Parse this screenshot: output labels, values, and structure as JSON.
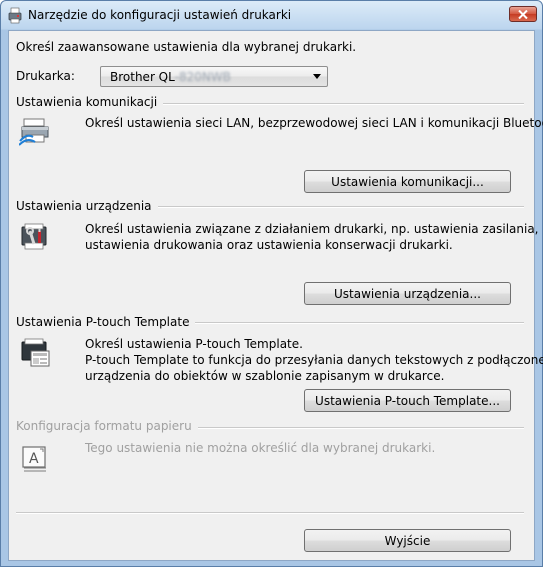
{
  "window": {
    "title": "Narzędzie do konfiguracji ustawień drukarki"
  },
  "intro": "Określ zaawansowane ustawienia dla wybranej drukarki.",
  "printer": {
    "label": "Drukarka:",
    "value_prefix": "Brother QL",
    "value_masked": "-820NWB"
  },
  "sections": {
    "communication": {
      "title": "Ustawienia komunikacji",
      "desc_lines": [
        "Określ ustawienia sieci LAN, bezprzewodowej sieci LAN i komunikacji Bluetooth."
      ],
      "button": "Ustawienia komunikacji..."
    },
    "device": {
      "title": "Ustawienia urządzenia",
      "desc_lines": [
        "Określ ustawienia związane z działaniem drukarki, np. ustawienia zasilania,",
        "ustawienia drukowania oraz ustawienia konserwacji drukarki."
      ],
      "button": "Ustawienia urządzenia..."
    },
    "ptouch": {
      "title": "Ustawienia P-touch Template",
      "desc_lines": [
        "Określ ustawienia P-touch Template.",
        "P-touch Template to funkcja do przesyłania danych tekstowych z podłączonego",
        "urządzenia do obiektów w szablonie zapisanym w drukarce."
      ],
      "button": "Ustawienia P-touch Template..."
    },
    "paper": {
      "title": "Konfiguracja formatu papieru",
      "desc_lines": [
        "Tego ustawienia nie można określić dla wybranej drukarki."
      ]
    }
  },
  "exit_button": "Wyjście",
  "icons": {
    "title": "printer-tool-icon",
    "communication": "network-printer-icon",
    "device": "tools-printer-icon",
    "ptouch": "template-printer-icon",
    "paper": "paper-format-icon",
    "close": "close-icon"
  },
  "colors": {
    "titlebar": "#bcd5ee",
    "close": "#c53b23",
    "dialog_bg": "#f0f0f0",
    "disabled_text": "#a0a0a0"
  }
}
